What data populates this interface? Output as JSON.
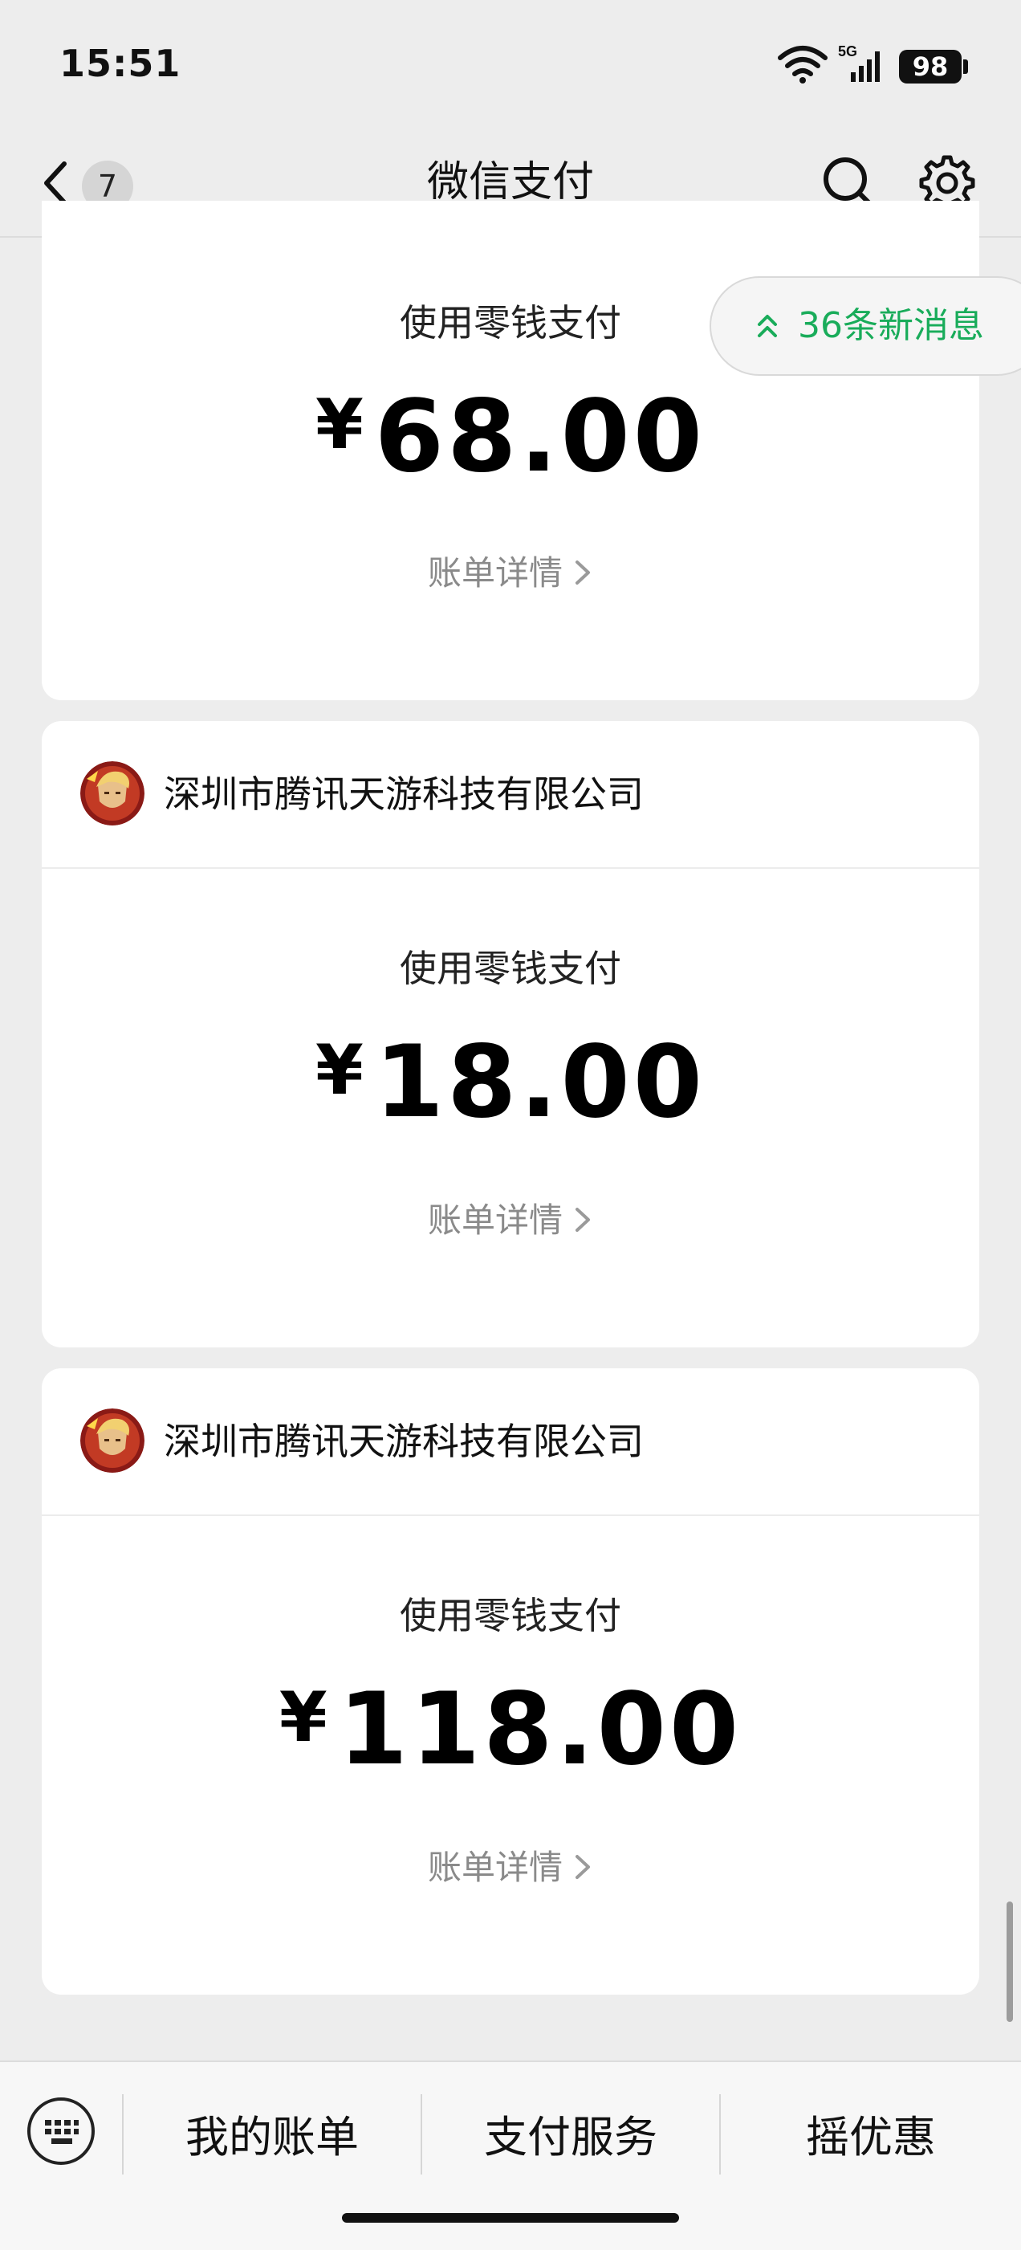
{
  "status": {
    "time": "15:51",
    "network": "5G",
    "battery": "98"
  },
  "nav": {
    "title": "微信支付",
    "back_count": "7"
  },
  "new_messages": "36条新消息",
  "cards": [
    {
      "merchant": "",
      "method": "使用零钱支付",
      "currency": "¥",
      "amount": "68.00",
      "detail_label": "账单详情"
    },
    {
      "merchant": "深圳市腾讯天游科技有限公司",
      "method": "使用零钱支付",
      "currency": "¥",
      "amount": "18.00",
      "detail_label": "账单详情"
    },
    {
      "merchant": "深圳市腾讯天游科技有限公司",
      "method": "使用零钱支付",
      "currency": "¥",
      "amount": "118.00",
      "detail_label": "账单详情"
    }
  ],
  "bottom_menu": [
    {
      "label": "我的账单"
    },
    {
      "label": "支付服务"
    },
    {
      "label": "摇优惠"
    }
  ],
  "colors": {
    "accent_green": "#19ac5a",
    "background": "#ededed"
  },
  "icons": [
    "back-arrow-icon",
    "search-icon",
    "gear-icon",
    "wifi-icon",
    "signal-icon",
    "battery-icon",
    "double-chevron-up-icon",
    "chevron-right-icon",
    "keyboard-icon"
  ]
}
